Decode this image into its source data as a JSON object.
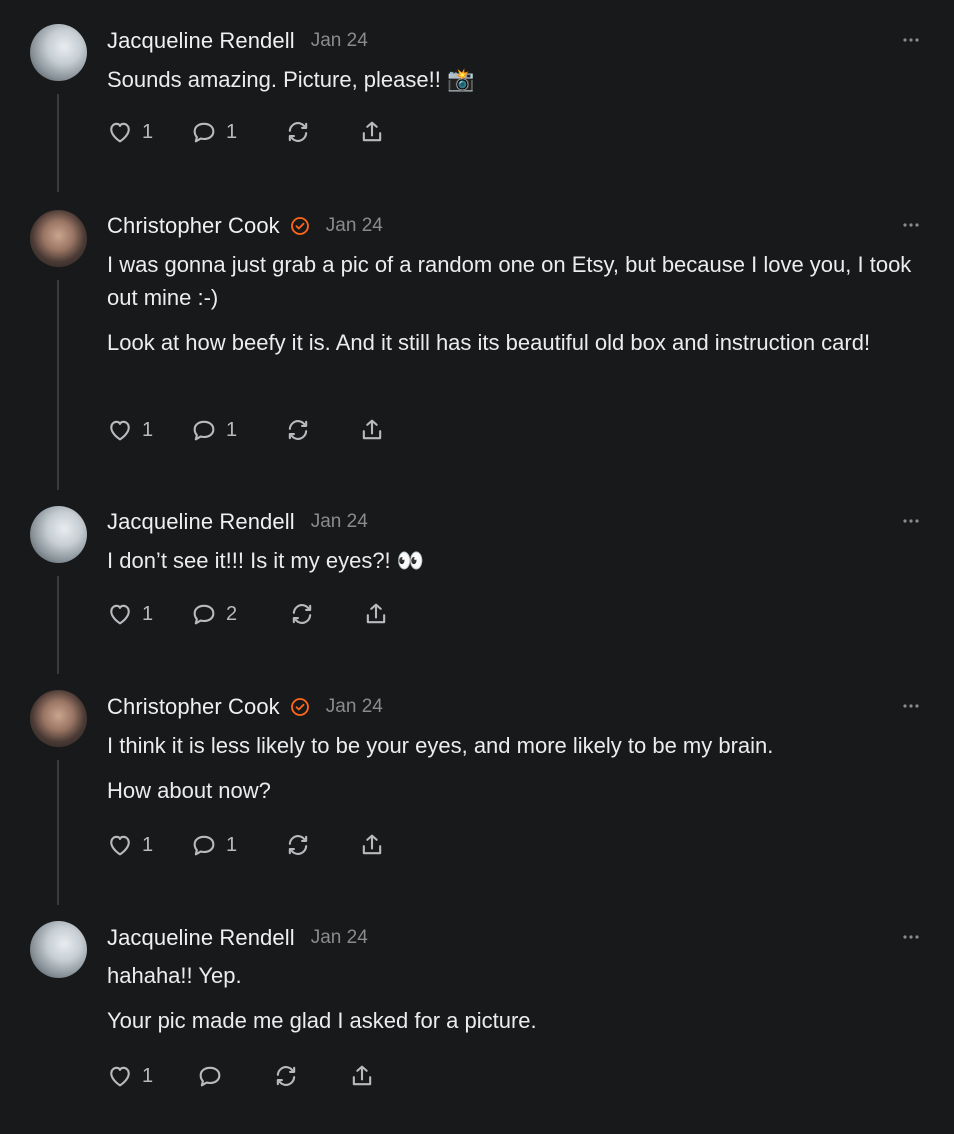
{
  "comments": [
    {
      "author": "Jacqueline Rendell",
      "verified": false,
      "date": "Jan 24",
      "paragraphs": [
        "Sounds amazing. Picture, please!! 📸"
      ],
      "likes": "1",
      "replies": "1"
    },
    {
      "author": "Christopher Cook",
      "verified": true,
      "date": "Jan 24",
      "paragraphs": [
        "I was gonna just grab a pic of a random one on Etsy, but because I love you, I took out mine :-)",
        "Look at how beefy it is. And it still has its beautiful old box and instruction card!"
      ],
      "likes": "1",
      "replies": "1"
    },
    {
      "author": "Jacqueline Rendell",
      "verified": false,
      "date": "Jan 24",
      "paragraphs": [
        "I don’t see it!!! Is it my eyes?! 👀"
      ],
      "likes": "1",
      "replies": "2"
    },
    {
      "author": "Christopher Cook",
      "verified": true,
      "date": "Jan 24",
      "paragraphs": [
        "I think it is less likely to be your eyes, and more likely to be my brain.",
        "How about now?"
      ],
      "likes": "1",
      "replies": "1"
    },
    {
      "author": "Jacqueline Rendell",
      "verified": false,
      "date": "Jan 24",
      "paragraphs": [
        "hahaha!! Yep.",
        "Your pic made me glad I asked for a picture."
      ],
      "likes": "1",
      "replies": ""
    }
  ],
  "colors": {
    "background": "#18191b",
    "text": "#ececec",
    "muted": "#8a8b8e",
    "icon": "#b9babd",
    "verified_badge": "#ff6719",
    "thread_line": "#3a3b3e"
  },
  "icons": {
    "like": "heart-icon",
    "reply": "speech-bubble-icon",
    "restack": "restack-arrows-icon",
    "share": "share-upload-icon",
    "more": "more-dots-icon",
    "verified": "verified-check-icon"
  }
}
